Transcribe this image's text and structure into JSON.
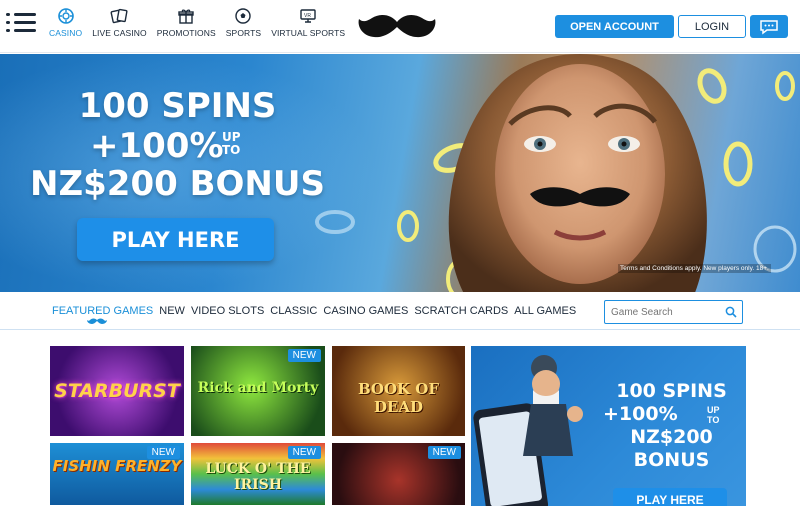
{
  "nav": {
    "items": [
      {
        "label": "CASINO",
        "icon": "casino-chip-icon"
      },
      {
        "label": "LIVE CASINO",
        "icon": "cards-icon"
      },
      {
        "label": "PROMOTIONS",
        "icon": "gift-icon"
      },
      {
        "label": "SPORTS",
        "icon": "soccer-ball-icon"
      },
      {
        "label": "VIRTUAL SPORTS",
        "icon": "virtual-screen-icon"
      }
    ]
  },
  "header": {
    "open_account_label": "OPEN ACCOUNT",
    "login_label": "LOGIN"
  },
  "hero": {
    "line1": "100 SPINS",
    "line2": "+100%",
    "line2_up": "UP",
    "line2_to": "TO",
    "line3": "NZ$200 BONUS",
    "cta": "PLAY HERE",
    "terms": "Terms and Conditions apply. New players only. 18+."
  },
  "tabs": [
    "FEATURED GAMES",
    "NEW",
    "VIDEO SLOTS",
    "CLASSIC",
    "CASINO GAMES",
    "SCRATCH CARDS",
    "ALL GAMES"
  ],
  "search": {
    "placeholder": "Game Search"
  },
  "games": [
    {
      "title": "STARBURST",
      "badge": ""
    },
    {
      "title": "Rick and Morty",
      "badge": "NEW"
    },
    {
      "title": "BOOK OF DEAD",
      "badge": ""
    },
    {
      "title": "FISHIN FRENZY",
      "badge": "NEW"
    },
    {
      "title": "LUCK O' THE IRISH",
      "badge": "NEW"
    },
    {
      "title": "",
      "badge": "NEW"
    }
  ],
  "promo": {
    "line1": "100 SPINS",
    "line2": "+100%",
    "line2_up": "UP",
    "line2_to": "TO",
    "line3": "NZ$200",
    "line4": "BONUS",
    "cta": "PLAY HERE"
  },
  "colors": {
    "accent": "#1d8fe0",
    "text": "#1c2a3a"
  }
}
